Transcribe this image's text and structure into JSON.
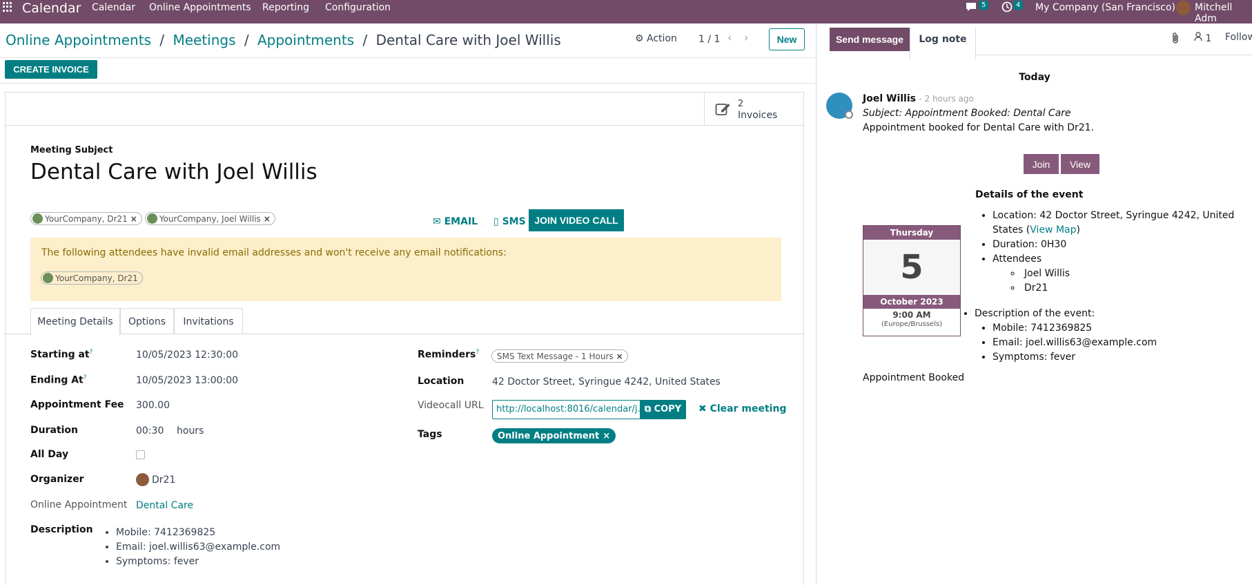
{
  "topbar": {
    "brand": "Calendar",
    "menu": [
      "Calendar",
      "Online Appointments",
      "Reporting",
      "Configuration"
    ],
    "messages_count": "5",
    "activities_count": "4",
    "company": "My Company (San Francisco)",
    "user": "Mitchell Adm"
  },
  "breadcrumb": {
    "items": [
      "Online Appointments",
      "Meetings",
      "Appointments"
    ],
    "separator": "/",
    "current": "Dental Care with Joel Willis"
  },
  "control": {
    "action_label": "Action",
    "pager": "1 / 1",
    "new_label": "New",
    "create_invoice_label": "CREATE INVOICE"
  },
  "smart_button": {
    "count": "2",
    "label": "Invoices"
  },
  "form": {
    "subject_label": "Meeting Subject",
    "subject": "Dental Care with Joel Willis",
    "attendees": [
      "YourCompany, Dr21",
      "YourCompany, Joel Willis"
    ],
    "email_label": "EMAIL",
    "sms_label": "SMS",
    "join_label": "JOIN VIDEO CALL",
    "warning_text": "The following attendees have invalid email addresses and won't receive any email notifications:",
    "warning_attendee": "YourCompany, Dr21",
    "tabs": [
      "Meeting Details",
      "Options",
      "Invitations"
    ],
    "fields": {
      "starting_label": "Starting at",
      "starting_value": "10/05/2023 12:30:00",
      "ending_label": "Ending At",
      "ending_value": "10/05/2023 13:00:00",
      "fee_label": "Appointment Fee",
      "fee_value": "300.00",
      "duration_label": "Duration",
      "duration_value": "00:30",
      "duration_unit": "hours",
      "allday_label": "All Day",
      "organizer_label": "Organizer",
      "organizer_value": "Dr21",
      "online_label": "Online Appointment",
      "online_value": "Dental Care",
      "description_label": "Description",
      "description_items": [
        "Mobile: 7412369825",
        "Email: joel.willis63@example.com",
        "Symptoms: fever"
      ],
      "reminders_label": "Reminders",
      "reminders_value": "SMS Text Message - 1 Hours",
      "location_label": "Location",
      "location_value": "42 Doctor Street, Syringue  4242, United States",
      "videocall_label": "Videocall URL",
      "videocall_value": "http://localhost:8016/calendar/j...",
      "copy_label": "COPY",
      "clear_label": "Clear meeting",
      "tags_label": "Tags",
      "tags_value": "Online Appointment",
      "help_mark": "?"
    }
  },
  "chatter": {
    "send_message": "Send message",
    "log_note": "Log note",
    "followers_count": "1",
    "follow_label": "Follow",
    "date_sep": "Today",
    "author": "Joel Willis",
    "time": "- 2 hours ago",
    "subject": "Subject: Appointment Booked: Dental Care",
    "body": "Appointment booked for Dental Care with Dr21.",
    "join_label": "Join",
    "view_label": "View",
    "details_title": "Details of the event",
    "location_prefix": "Location: 42 Doctor Street, Syringue 4242, United States",
    "view_map": "View Map",
    "duration": "Duration: 0H30",
    "attendees_label": "Attendees",
    "attendees": [
      "Joel Willis",
      "Dr21"
    ],
    "description_label": "Description of the event:",
    "description_items": [
      "Mobile: 7412369825",
      "Email: joel.willis63@example.com",
      "Symptoms: fever"
    ],
    "footer": "Appointment Booked",
    "calendar": {
      "weekday": "Thursday",
      "day": "5",
      "month": "October 2023",
      "time": "9:00 AM",
      "tz": "(Europe/Brussels)"
    }
  },
  "colors": {
    "brand": "#714b67",
    "accent": "#017e84",
    "warning_bg": "#fdeecc",
    "warning_text": "#8a6d00",
    "button_purple": "#875a7b"
  }
}
